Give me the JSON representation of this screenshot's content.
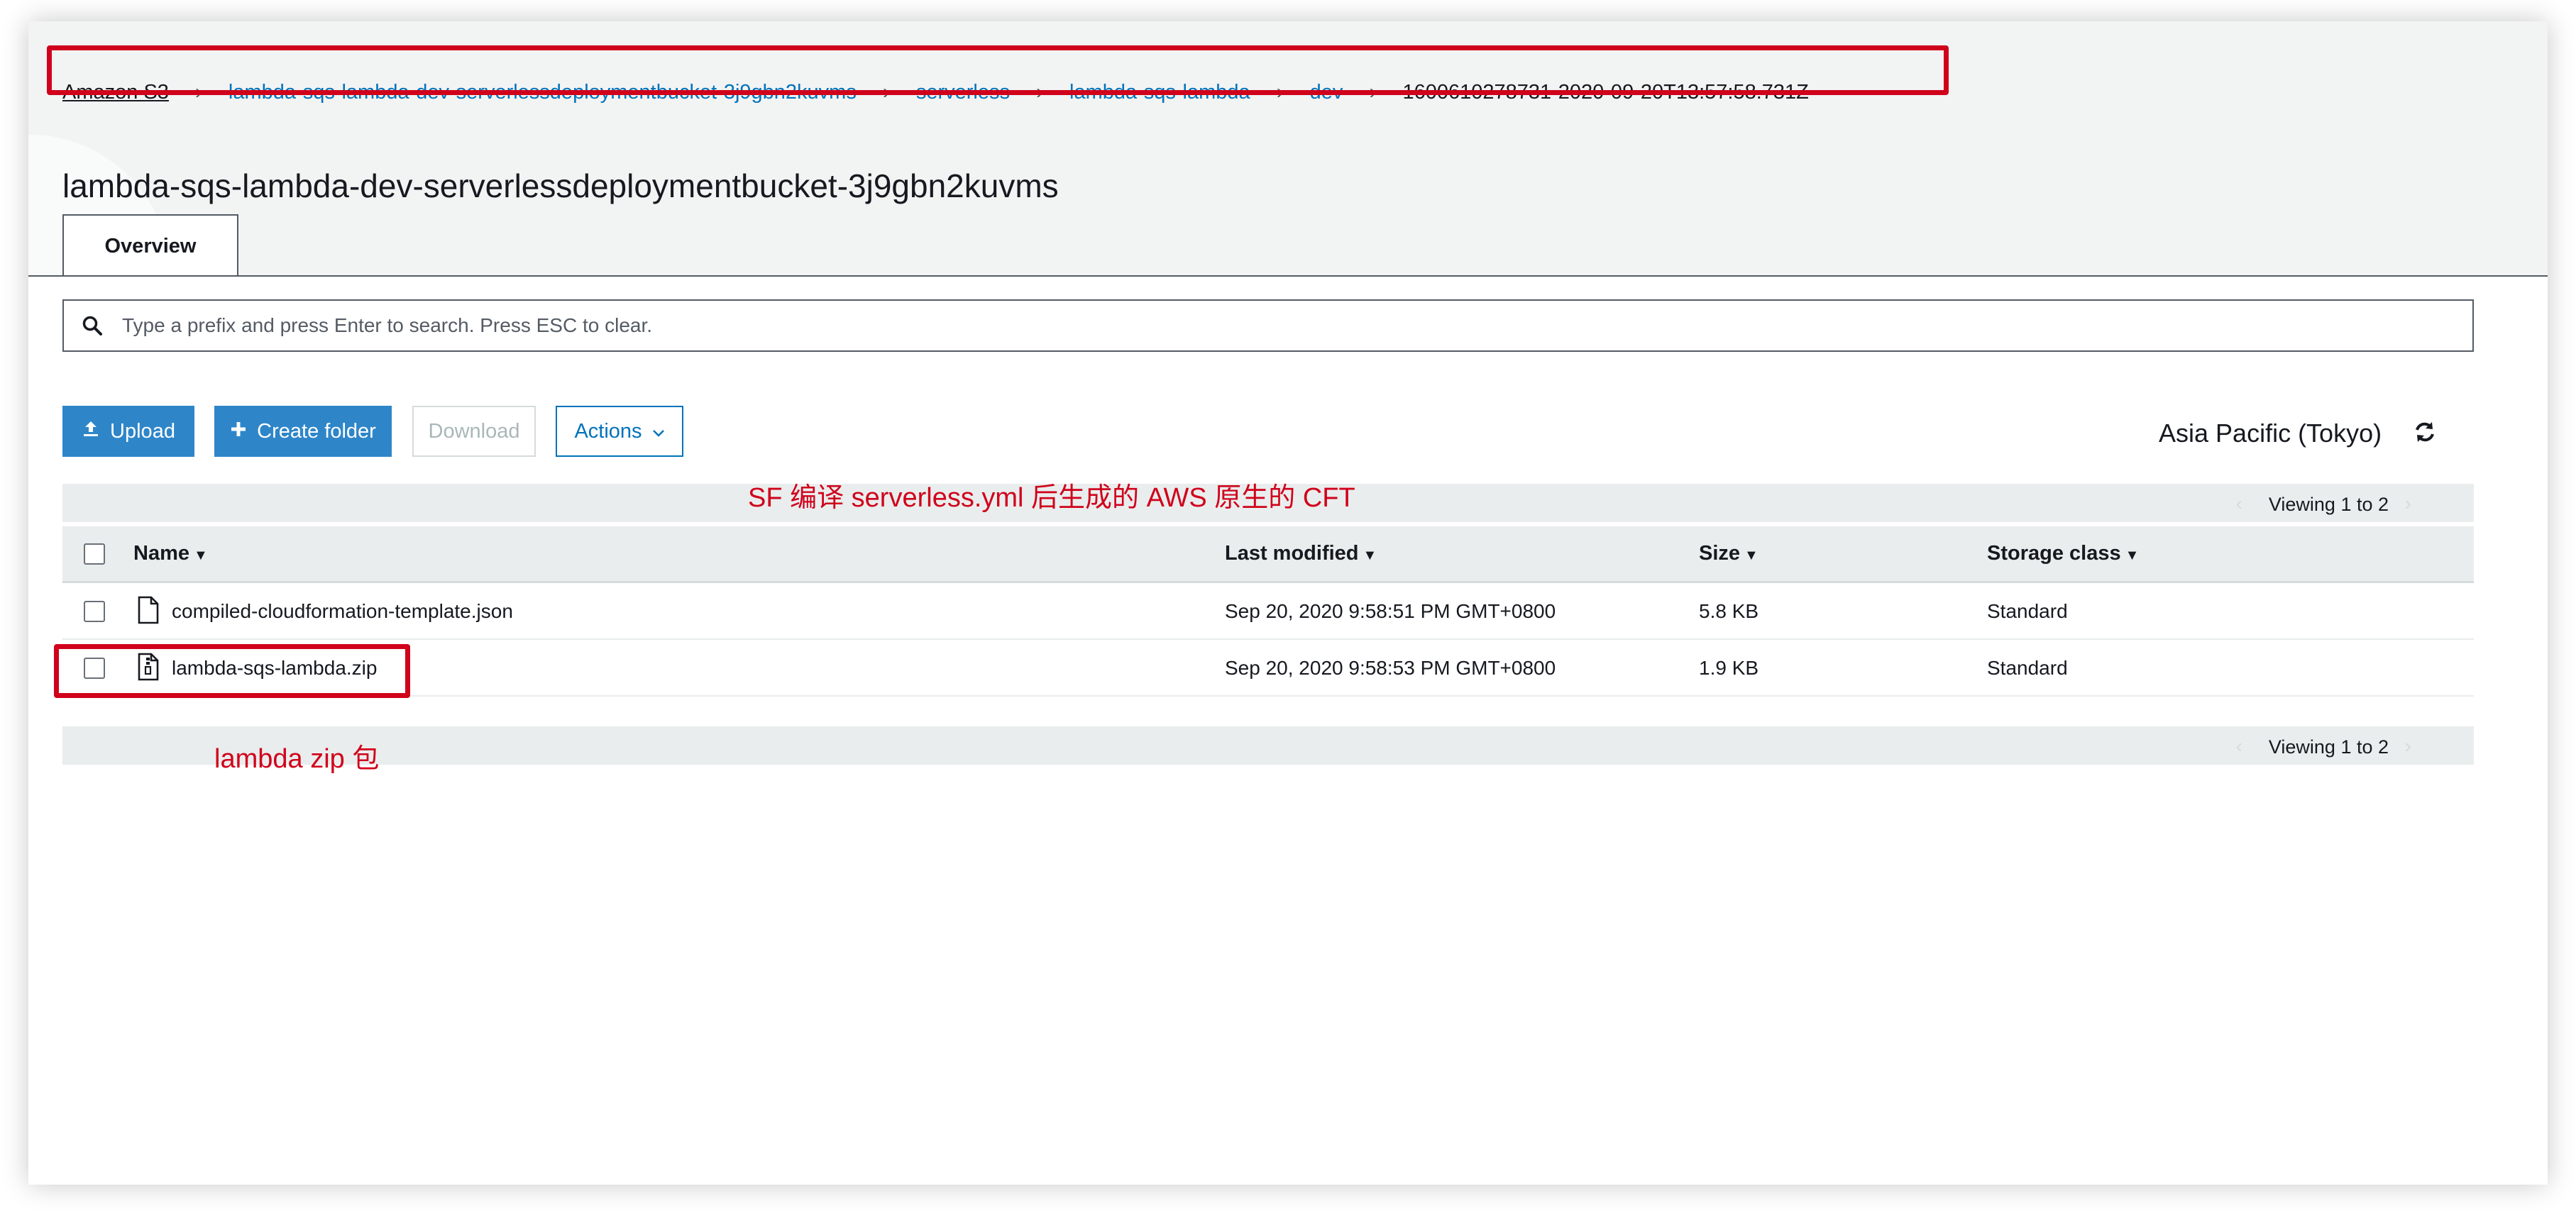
{
  "breadcrumb": [
    {
      "label": "Amazon S3"
    },
    {
      "label": "lambda-sqs-lambda-dev-serverlessdeploymentbucket-3j9gbn2kuvms"
    },
    {
      "label": "serverless"
    },
    {
      "label": "lambda-sqs-lambda"
    },
    {
      "label": "dev"
    },
    {
      "label": "1600610278731-2020-09-20T13:57:58.731Z"
    }
  ],
  "page_title": "lambda-sqs-lambda-dev-serverlessdeploymentbucket-3j9gbn2kuvms",
  "tabs": [
    {
      "label": "Overview"
    }
  ],
  "search": {
    "placeholder": "Type a prefix and press Enter to search. Press ESC to clear."
  },
  "toolbar": {
    "upload_label": "Upload",
    "create_folder_label": "Create folder",
    "download_label": "Download",
    "actions_label": "Actions"
  },
  "region": "Asia Pacific (Tokyo)",
  "pager": {
    "text": "Viewing 1 to 2"
  },
  "table": {
    "columns": [
      "Name",
      "Last modified",
      "Size",
      "Storage class"
    ],
    "rows": [
      {
        "name": "compiled-cloudformation-template.json",
        "modified": "Sep 20, 2020 9:58:51 PM GMT+0800",
        "size": "5.8 KB",
        "storage": "Standard",
        "icon": "file-icon"
      },
      {
        "name": "lambda-sqs-lambda.zip",
        "modified": "Sep 20, 2020 9:58:53 PM GMT+0800",
        "size": "1.9 KB",
        "storage": "Standard",
        "icon": "zip-file-icon"
      }
    ]
  },
  "annotations": {
    "cft_note": "SF 编译 serverless.yml 后生成的 AWS 原生的 CFT",
    "zip_note": "lambda zip 包"
  },
  "colors": {
    "link": "#0073bb",
    "primary_button": "#2e86c9",
    "annotation_red": "#d0021b",
    "header_bg": "#f2f3f3"
  }
}
